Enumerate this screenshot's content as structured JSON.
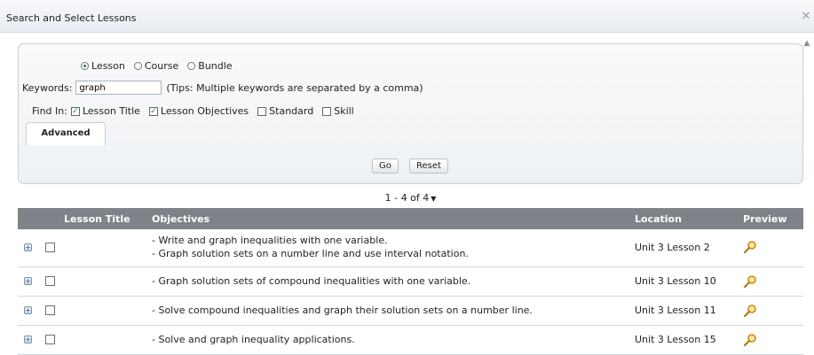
{
  "dialog": {
    "title": "Search and Select Lessons",
    "close_icon": "close-icon"
  },
  "search": {
    "types": [
      {
        "label": "Lesson",
        "checked": true
      },
      {
        "label": "Course",
        "checked": false
      },
      {
        "label": "Bundle",
        "checked": false
      }
    ],
    "keywords_label": "Keywords:",
    "keywords_value": "graph",
    "tips": "(Tips: Multiple keywords are separated by a comma)",
    "find_in_label": "Find In:",
    "find_in": [
      {
        "label": "Lesson Title",
        "checked": true
      },
      {
        "label": "Lesson Objectives",
        "checked": true
      },
      {
        "label": "Standard",
        "checked": false
      },
      {
        "label": "Skill",
        "checked": false
      }
    ],
    "advanced_tab": "Advanced",
    "go_label": "Go",
    "reset_label": "Reset"
  },
  "pager": {
    "text": "1 - 4 of 4"
  },
  "table": {
    "headers": {
      "lesson_title": "Lesson Title",
      "objectives": "Objectives",
      "location": "Location",
      "preview": "Preview"
    },
    "rows": [
      {
        "objectives": [
          "- Write and graph inequalities with one variable.",
          "- Graph solution sets on a number line and use interval notation."
        ],
        "location": "Unit 3 Lesson 2"
      },
      {
        "objectives": [
          "- Graph solution sets of compound inequalities with one variable."
        ],
        "location": "Unit 3 Lesson 10"
      },
      {
        "objectives": [
          "- Solve compound inequalities and graph their solution sets on a number line."
        ],
        "location": "Unit 3 Lesson 11"
      },
      {
        "objectives": [
          "- Solve and graph inequality applications."
        ],
        "location": "Unit 3 Lesson 15"
      }
    ]
  },
  "colors": {
    "header_bg": "#7f8389",
    "check_green": "#2e8b3e",
    "magnifier": "#e0a020"
  }
}
